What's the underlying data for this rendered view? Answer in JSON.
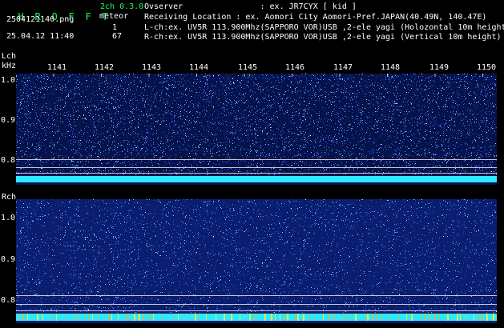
{
  "app": {
    "title_letters": [
      "H",
      "R",
      "O",
      "F",
      "F",
      "T"
    ],
    "version": "2ch 0.3.0",
    "filename": "2504121140.png",
    "datetime": "25.04.12 11:40",
    "meteor_label": "meteor",
    "meteor_count": "1",
    "meteor_total": "67"
  },
  "info": {
    "observer": "Ovserver                : ex. JR7CYX [ kid ]",
    "location": "Receiving Location : ex. Aomori City Aomori-Pref.JAPAN(40.49N, 140.47E)",
    "lch": "L-ch:ex. UV5R 113.900Mhz(SAPPORO VOR)USB ,2-ele yagi (Holozontal 10m height",
    "rch": "R-ch:ex. UV5R 113.900Mhz(SAPPORO VOR)USB ,2-ele yagi (Vertical 10m height)"
  },
  "lch_panel": {
    "label": "Lch",
    "unit": "kHz",
    "y_ticks": [
      "1.0",
      "0.9",
      "0.8"
    ],
    "x_ticks": [
      "1141",
      "1142",
      "1143",
      "1144",
      "1145",
      "1146",
      "1147",
      "1148",
      "1149",
      "1150"
    ]
  },
  "rch_panel": {
    "label": "Rch",
    "y_ticks": [
      "1.0",
      "0.9",
      "0.8"
    ]
  },
  "colors": {
    "background": "#000000",
    "noise": "#0a2a8a",
    "signal_band": "#2ee8ff",
    "text_green": "#19ff5a",
    "text_white": "#ffffff",
    "grid": "#c8c8c8"
  }
}
